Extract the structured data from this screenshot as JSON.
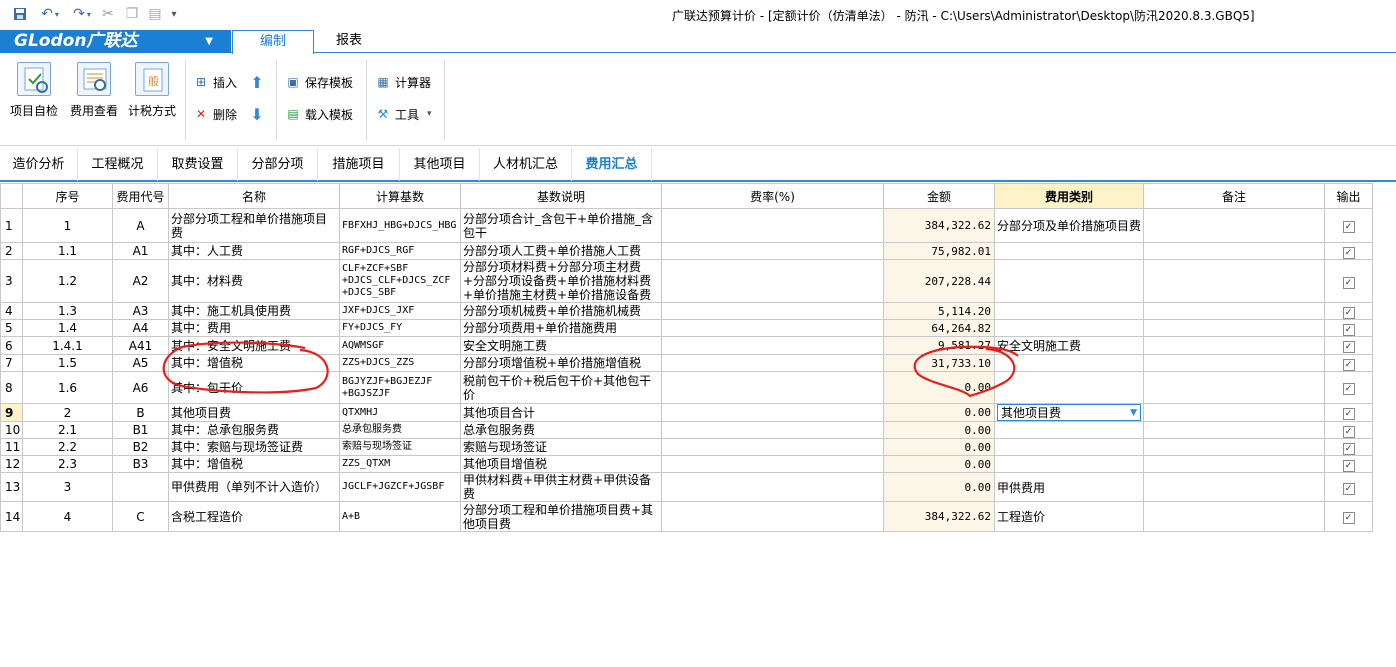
{
  "window": {
    "title": "广联达预算计价 - [定额计价（仿清单法） - 防汛 - C:\\Users\\Administrator\\Desktop\\防汛2020.8.3.GBQ5]"
  },
  "brand": {
    "name": "GLodon广联达"
  },
  "ribbon_tabs": [
    "编制",
    "报表"
  ],
  "ribbon": {
    "big_buttons": [
      "项目自检",
      "费用查看",
      "计税方式"
    ],
    "small_buttons": {
      "insert": "插入",
      "delete": "删除",
      "save_template": "保存模板",
      "load_template": "载入模板",
      "calculator": "计算器",
      "tools": "工具"
    }
  },
  "page_tabs": [
    "造价分析",
    "工程概况",
    "取费设置",
    "分部分项",
    "措施项目",
    "其他项目",
    "人材机汇总",
    "费用汇总"
  ],
  "active_page_tab": "费用汇总",
  "table": {
    "headers": [
      "序号",
      "费用代号",
      "名称",
      "计算基数",
      "基数说明",
      "费率(%)",
      "金额",
      "费用类别",
      "备注",
      "输出"
    ],
    "rows": [
      {
        "n": "1",
        "seq": "1",
        "code": "A",
        "name": "分部分项工程和单价措施项目费",
        "base": "FBFXHJ_HBG+DJCS_HBG",
        "desc": "分部分项合计_含包干+单价措施_含包干",
        "rate": "",
        "amount": "384,322.62",
        "category": "分部分项及单价措施项目费",
        "note": ""
      },
      {
        "n": "2",
        "seq": "1.1",
        "code": "A1",
        "name": "其中：人工费",
        "base": "RGF+DJCS_RGF",
        "desc": "分部分项人工费+单价措施人工费",
        "rate": "",
        "amount": "75,982.01",
        "category": "",
        "note": ""
      },
      {
        "n": "3",
        "seq": "1.2",
        "code": "A2",
        "name": "其中：材料费",
        "base": "CLF+ZCF+SBF +DJCS_CLF+DJCS_ZCF +DJCS_SBF",
        "desc": "分部分项材料费+分部分项主材费+分部分项设备费+单价措施材料费+单价措施主材费+单价措施设备费",
        "rate": "",
        "amount": "207,228.44",
        "category": "",
        "note": ""
      },
      {
        "n": "4",
        "seq": "1.3",
        "code": "A3",
        "name": "其中：施工机具使用费",
        "base": "JXF+DJCS_JXF",
        "desc": "分部分项机械费+单价措施机械费",
        "rate": "",
        "amount": "5,114.20",
        "category": "",
        "note": ""
      },
      {
        "n": "5",
        "seq": "1.4",
        "code": "A4",
        "name": "其中：费用",
        "base": "FY+DJCS_FY",
        "desc": "分部分项费用+单价措施费用",
        "rate": "",
        "amount": "64,264.82",
        "category": "",
        "note": ""
      },
      {
        "n": "6",
        "seq": "1.4.1",
        "code": "A41",
        "name": "其中：安全文明施工费",
        "base": "AQWMSGF",
        "desc": "安全文明施工费",
        "rate": "",
        "amount": "9,581.27",
        "category": "安全文明施工费",
        "note": ""
      },
      {
        "n": "7",
        "seq": "1.5",
        "code": "A5",
        "name": "其中：增值税",
        "base": "ZZS+DJCS_ZZS",
        "desc": "分部分项增值税+单价措施增值税",
        "rate": "",
        "amount": "31,733.10",
        "category": "",
        "note": ""
      },
      {
        "n": "8",
        "seq": "1.6",
        "code": "A6",
        "name": "其中：包干价",
        "base": "BGJYZJF+BGJEZJF +BGJSZJF",
        "desc": "税前包干价+税后包干价+其他包干价",
        "rate": "",
        "amount": "0.00",
        "category": "",
        "note": ""
      },
      {
        "n": "9",
        "seq": "2",
        "code": "B",
        "name": "其他项目费",
        "base": "QTXMHJ",
        "desc": "其他项目合计",
        "rate": "",
        "amount": "0.00",
        "category": "其他项目费",
        "note": ""
      },
      {
        "n": "10",
        "seq": "2.1",
        "code": "B1",
        "name": "其中：总承包服务费",
        "base": "总承包服务费",
        "desc": "总承包服务费",
        "rate": "",
        "amount": "0.00",
        "category": "",
        "note": ""
      },
      {
        "n": "11",
        "seq": "2.2",
        "code": "B2",
        "name": "其中：索赔与现场签证费",
        "base": "索赔与现场签证",
        "desc": "索赔与现场签证",
        "rate": "",
        "amount": "0.00",
        "category": "",
        "note": ""
      },
      {
        "n": "12",
        "seq": "2.3",
        "code": "B3",
        "name": "其中：增值税",
        "base": "ZZS_QTXM",
        "desc": "其他项目增值税",
        "rate": "",
        "amount": "0.00",
        "category": "",
        "note": ""
      },
      {
        "n": "13",
        "seq": "3",
        "code": "",
        "name": "甲供费用（单列不计入造价）",
        "base": "JGCLF+JGZCF+JGSBF",
        "desc": "甲供材料费+甲供主材费+甲供设备费",
        "rate": "",
        "amount": "0.00",
        "category": "甲供费用",
        "note": ""
      },
      {
        "n": "14",
        "seq": "4",
        "code": "C",
        "name": "含税工程造价",
        "base": "A+B",
        "desc": "分部分项工程和单价措施项目费+其他项目费",
        "rate": "",
        "amount": "384,322.62",
        "category": "工程造价",
        "note": ""
      }
    ]
  },
  "colors": {
    "accent": "#1b7fd4",
    "annotation": "#e8201c",
    "highlight": "#fdf2c8"
  }
}
